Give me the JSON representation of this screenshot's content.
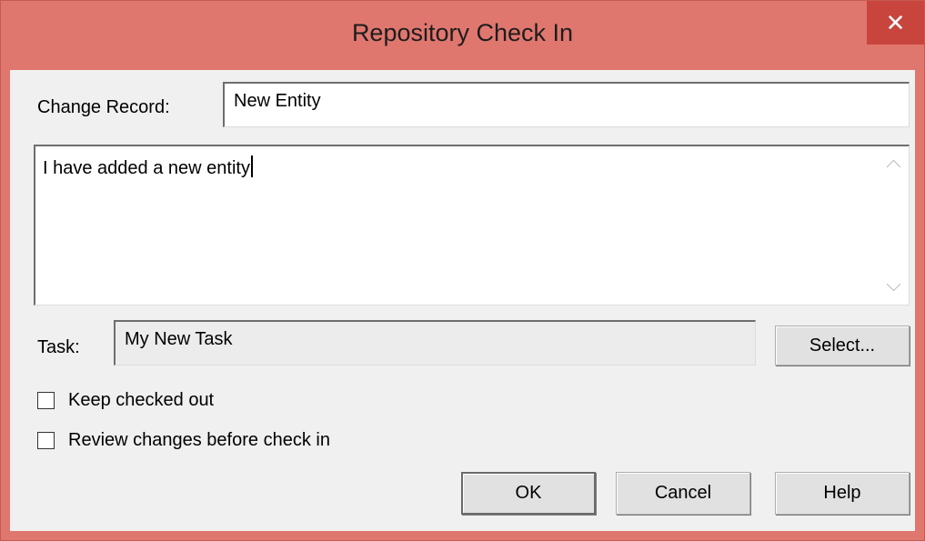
{
  "window": {
    "title": "Repository Check In",
    "close_symbol": "✕"
  },
  "change_record": {
    "label": "Change Record:",
    "value": "New Entity"
  },
  "description": {
    "value": "I have added a new entity"
  },
  "task": {
    "label": "Task:",
    "value": "My New Task",
    "select_label": "Select..."
  },
  "options": {
    "keep_checked_out": "Keep checked out",
    "review_changes": "Review changes before check in"
  },
  "buttons": {
    "ok": "OK",
    "cancel": "Cancel",
    "help": "Help"
  },
  "colors": {
    "titlebar": "#e0776f",
    "close": "#c7453d"
  }
}
